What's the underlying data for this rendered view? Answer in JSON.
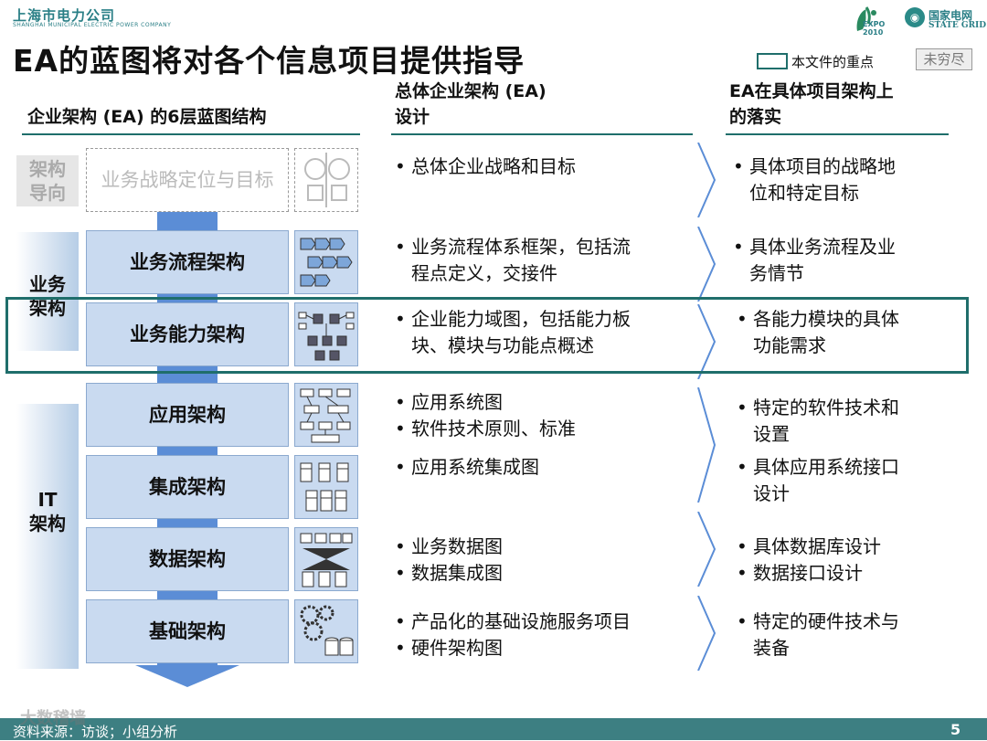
{
  "header": {
    "company_cn": "上海市电力公司",
    "company_en": "SHANGHAI MUNICIPAL ELECTRIC POWER COMPANY",
    "title": "EA的蓝图将对各个信息项目提供指导",
    "expo_logo_text": "EXPO 2010",
    "grid_logo_icon": "state-grid-logo-icon",
    "grid_logo_cn": "国家电网",
    "grid_logo_en": "STATE GRID"
  },
  "legend": {
    "label": "本文件的重点",
    "unfinished_badge": "未穷尽"
  },
  "columns": {
    "col1": "企业架构 (EA) 的6层蓝图结构",
    "col2_line1": "总体企业架构 (EA)",
    "col2_line2": "设计",
    "col3_line1": "EA在具体项目架构上",
    "col3_line2": "的落实"
  },
  "sidebar": {
    "group1_line1": "架构",
    "group1_line2": "导向",
    "group2_line1": "业务",
    "group2_line2": "架构",
    "group3_line1": "IT",
    "group3_line2": "架构"
  },
  "layers": [
    {
      "label": "业务战略定位与目标",
      "icon": "strategy-icon"
    },
    {
      "label": "业务流程架构",
      "icon": "process-flow-icon"
    },
    {
      "label": "业务能力架构",
      "icon": "capability-map-icon"
    },
    {
      "label": "应用架构",
      "icon": "application-diagram-icon"
    },
    {
      "label": "集成架构",
      "icon": "integration-icon"
    },
    {
      "label": "数据架构",
      "icon": "data-model-icon"
    },
    {
      "label": "基础架构",
      "icon": "infrastructure-gears-icon"
    }
  ],
  "design": {
    "strategy_line1": "总体企业战略和目标",
    "process_line1": "业务流程体系框架，包括流",
    "process_line2": "程点定义，交接件",
    "capability_line1": "企业能力域图，包括能力板",
    "capability_line2": "块、模块与功能点概述",
    "app_item1": "应用系统图",
    "app_item2": "软件技术原则、标准",
    "integration_item1": "应用系统集成图",
    "data_item1": "业务数据图",
    "data_item2": "数据集成图",
    "infra_item1": "产品化的基础设施服务项目",
    "infra_item2": "硬件架构图"
  },
  "implementation": {
    "strategy_line1": "具体项目的战略地",
    "strategy_line2": "位和特定目标",
    "process_line1": "具体业务流程及业",
    "process_line2": "务情节",
    "capability_line1": "各能力模块的具体",
    "capability_line2": "功能需求",
    "app_line1": "特定的软件技术和",
    "app_line2": "设置",
    "integration_line1": "具体应用系统接口",
    "integration_line2": "设计",
    "data_item1": "具体数据库设计",
    "data_item2": "数据接口设计",
    "infra_line1": "特定的硬件技术与",
    "infra_line2": "装备"
  },
  "footer": {
    "source": "资料来源：访谈；小组分析",
    "watermark": "大数稽墙",
    "page_number": "5"
  },
  "colors": {
    "accent": "#1f6e6b",
    "layer_fill": "#c9daf0",
    "arrow": "#5b8dd6",
    "footer_bar": "#3d7f82"
  }
}
